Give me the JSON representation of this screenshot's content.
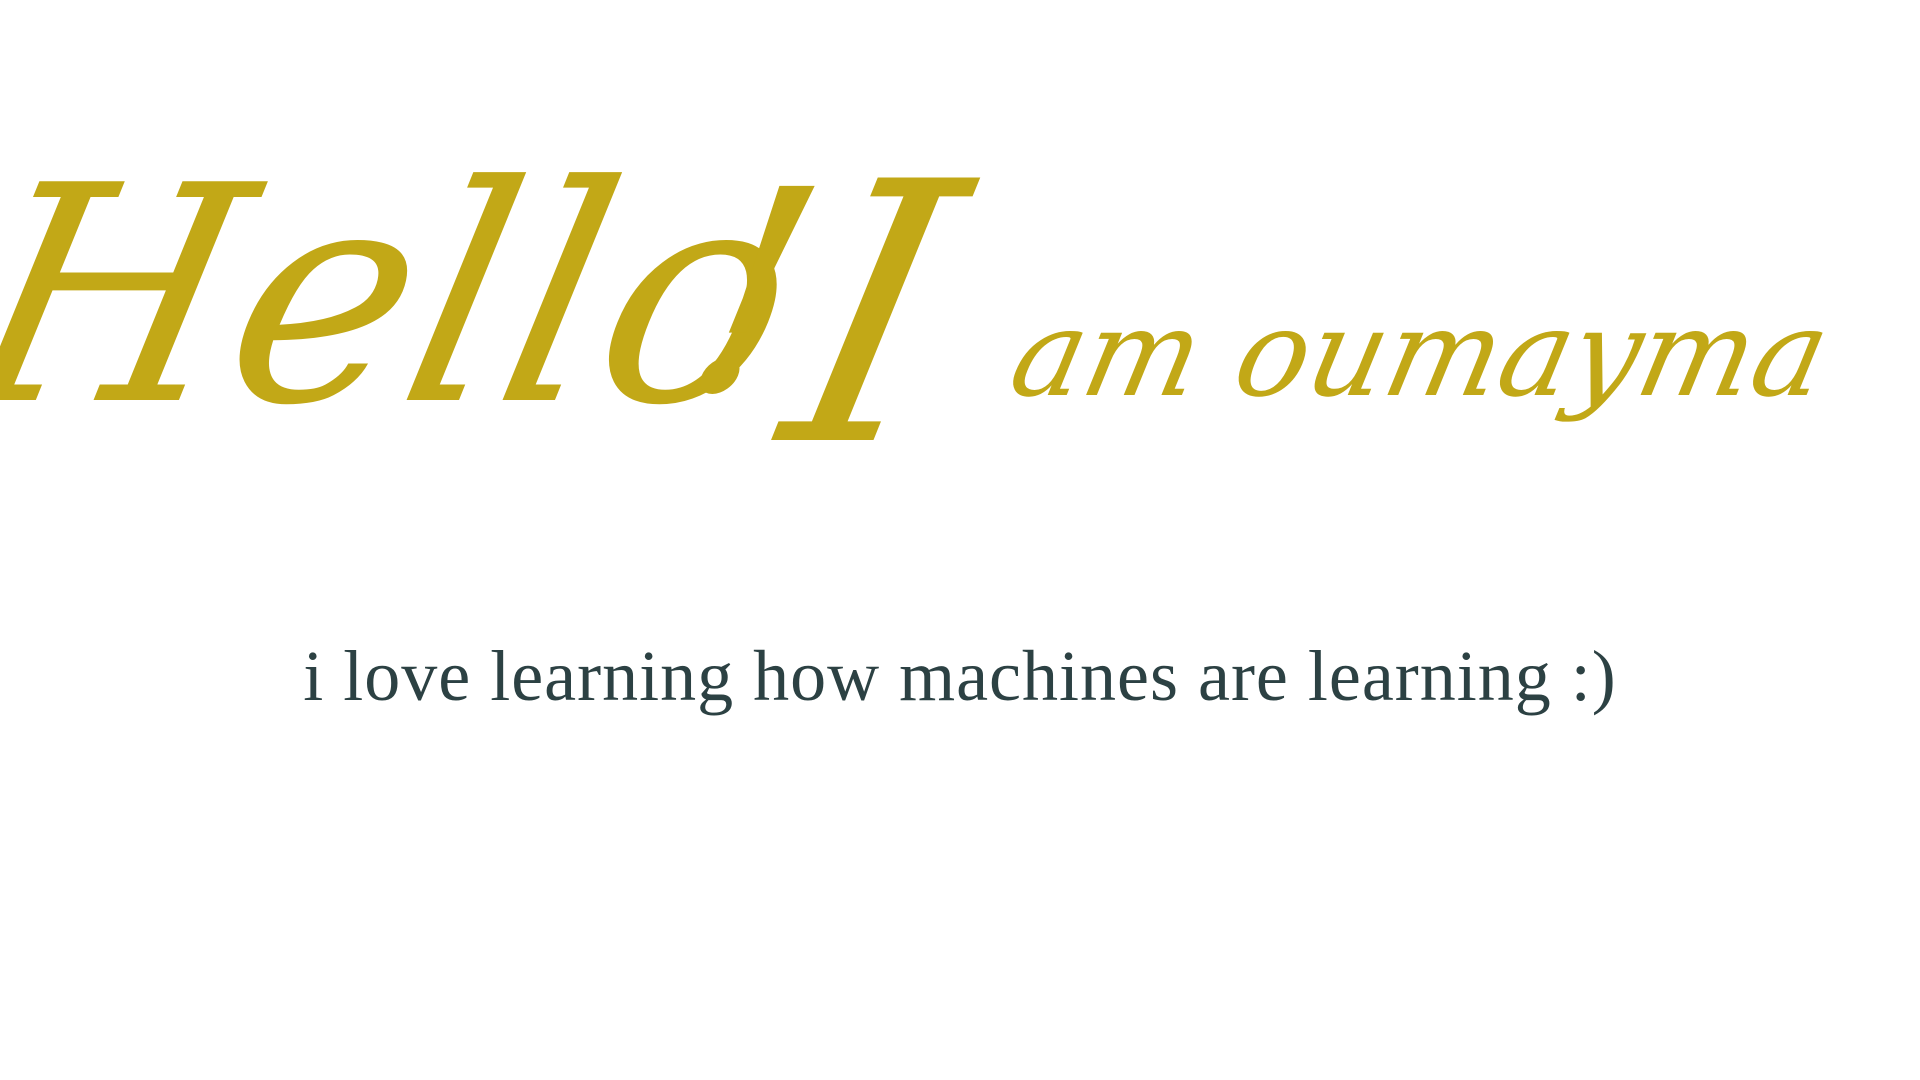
{
  "heading": {
    "hello": "Hello",
    "exclaim": "!",
    "i": "I",
    "rest": "am oumayma",
    "color": "#c2a817"
  },
  "tagline": {
    "text": "i love learning how machines are learning :)",
    "color": "#2c4143"
  }
}
